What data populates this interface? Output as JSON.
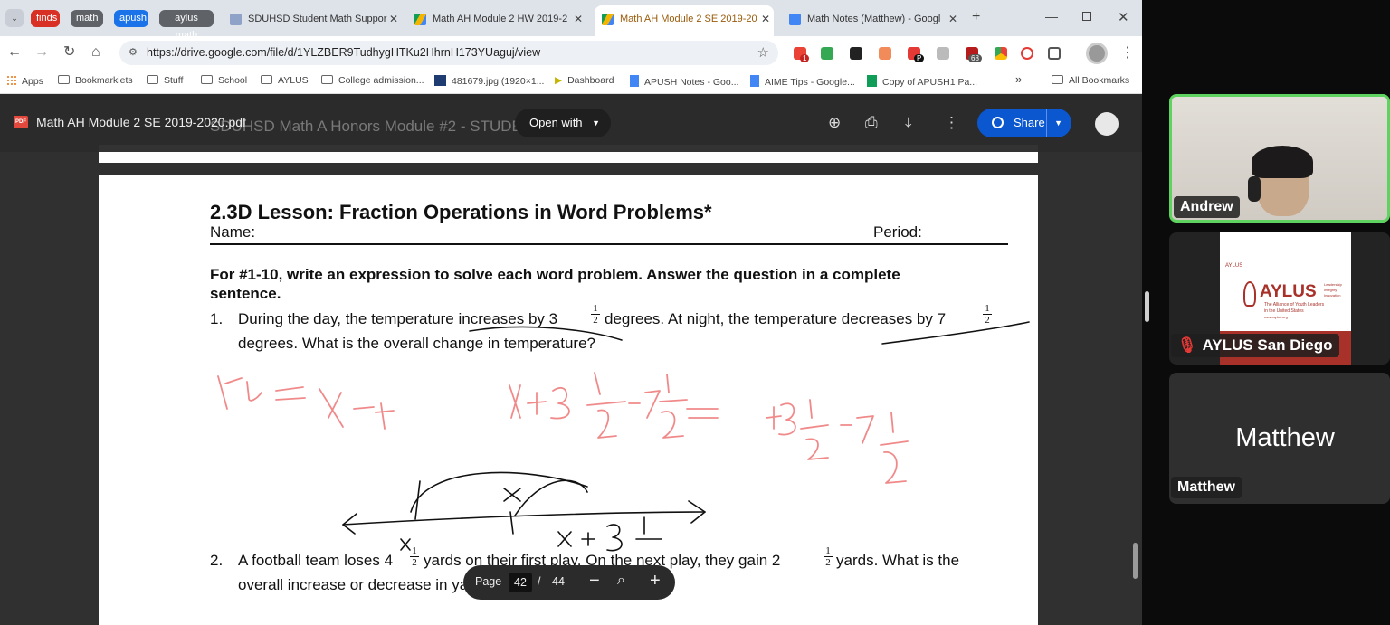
{
  "tab_groups": [
    {
      "label": "finds",
      "color": "#d93025"
    },
    {
      "label": "math",
      "color": "#5f6368"
    },
    {
      "label": "apush",
      "color": "#1a73e8"
    },
    {
      "label": "aylus math",
      "color": "#5f6368"
    }
  ],
  "tabs": [
    {
      "title": "SDUHSD Student Math Suppor",
      "active": false
    },
    {
      "title": "Math AH Module 2 HW 2019-2",
      "active": false
    },
    {
      "title": "Math AH Module 2 SE 2019-20",
      "active": true
    },
    {
      "title": "Math Notes (Matthew) - Googl",
      "active": false
    }
  ],
  "address": {
    "url": "https://drive.google.com/file/d/1YLZBER9TudhygHTKu2HhrnH173YUaguj/view"
  },
  "extensions": {
    "gmail_badge": "1",
    "p_badge": "P",
    "red_badge": "68"
  },
  "bookmarks": {
    "apps": "Apps",
    "items": [
      "Bookmarklets",
      "Stuff",
      "School",
      "AYLUS",
      "College admission...",
      "481679.jpg (1920×1...",
      "Dashboard",
      "APUSH Notes - Goo...",
      "AIME Tips - Google...",
      "Copy of APUSH1 Pa..."
    ],
    "more": "»",
    "all": "All Bookmarks"
  },
  "viewer": {
    "filename": "Math AH Module 2 SE 2019-2020.pdf",
    "open_with": "Open with",
    "share": "Share",
    "prev_page_header": "SDUHSD Math A Honors Module #2 - STUDENT EDITION",
    "pdf_badge": "PDF"
  },
  "document": {
    "title": "2.3D Lesson: Fraction Operations in Word Problems*",
    "name_label": "Name:",
    "period_label": "Period:",
    "instructions_1": "For #1-10, write an expression to solve each word problem.  Answer the question in a complete",
    "instructions_2": "sentence.",
    "q1_num": "1.",
    "q1_line1_a": "During the day, the temperature increases by 3",
    "q1_line1_b": "degrees.  At night, the temperature decreases by 7",
    "q1_line2": "degrees.  What is the overall change in temperature?",
    "q2_num": "2.",
    "q2_line1_a": "A football team loses 4",
    "q2_line1_b": "yards on their first play.  On the next play, they gain 2",
    "q2_line1_c": "yards.  What is the",
    "q2_line2": "overall increase or decrease in yards?",
    "frac_num": "1",
    "frac_den": "2"
  },
  "pager": {
    "label": "Page",
    "current": "42",
    "sep": "/",
    "total": "44"
  },
  "participants": [
    {
      "name": "Andrew",
      "active_speaker": true
    },
    {
      "name": "AYLUS San Diego",
      "muted": true
    },
    {
      "name": "Matthew",
      "muted": false
    }
  ],
  "aylus_logo": {
    "small": "AYLUS",
    "big": "AYLUS",
    "taglines": [
      "Leadership",
      "Integrity",
      "Innovation"
    ],
    "sub1": "The Alliance of Youth Leaders",
    "sub2": "in the United States",
    "url": "www.aylus.org"
  },
  "ink_color": "#f08a8a"
}
